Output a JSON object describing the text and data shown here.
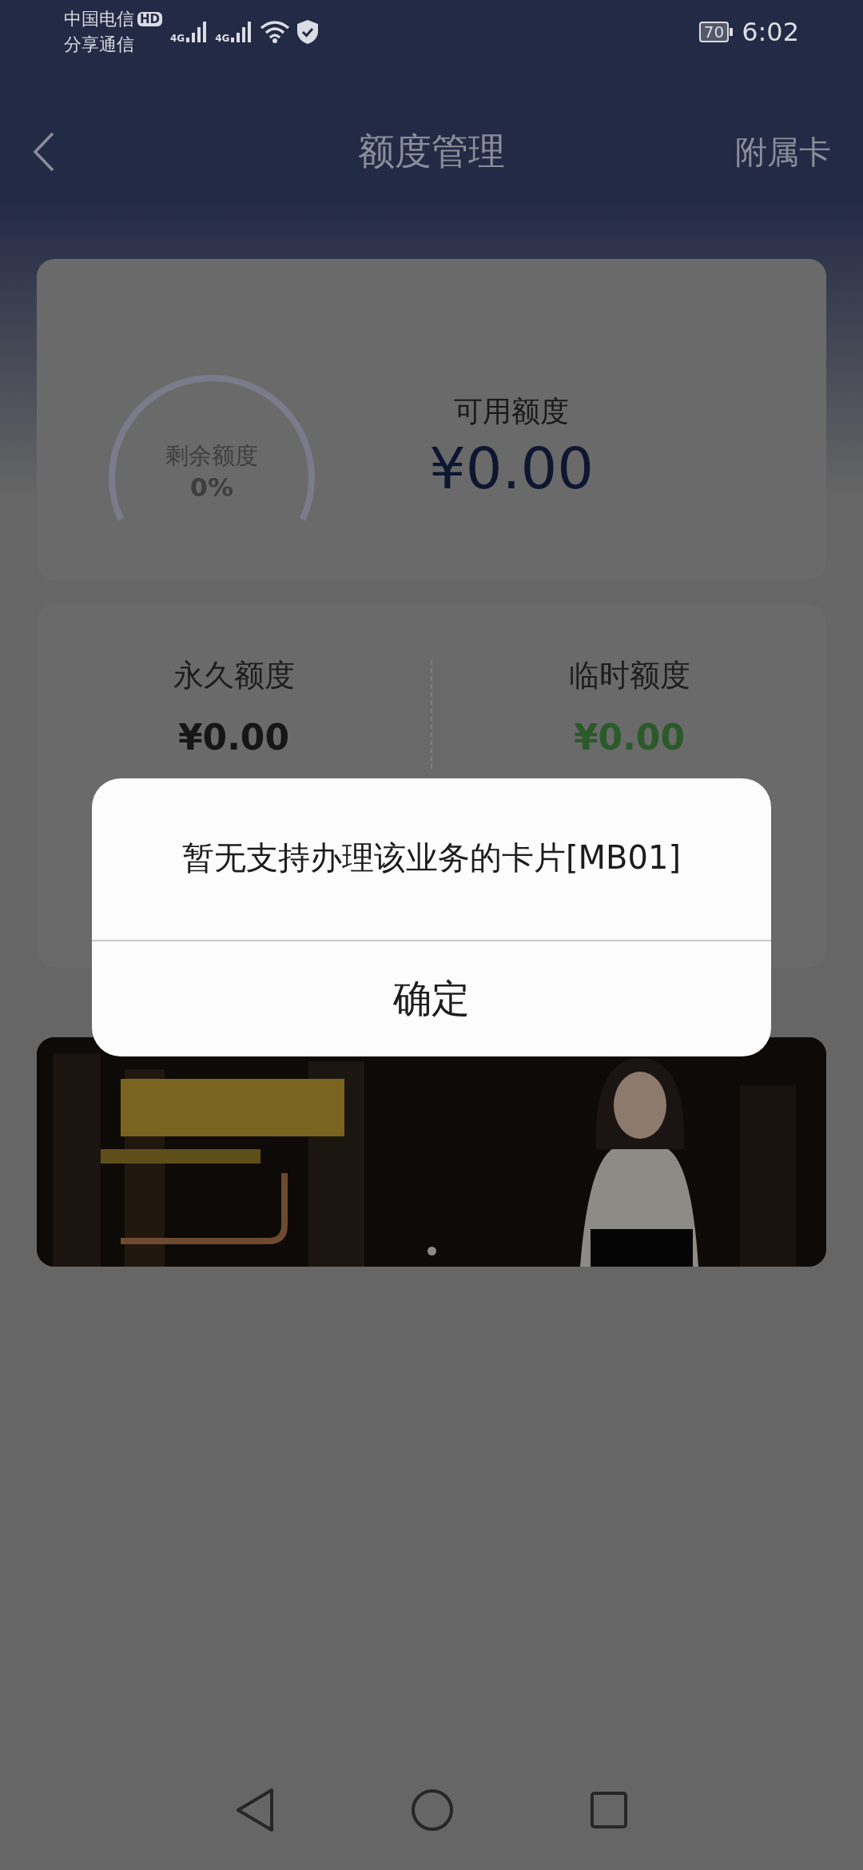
{
  "status_bar": {
    "carrier_primary": "中国电信",
    "hd_badge": "HD",
    "carrier_secondary": "分享通信",
    "network_1": "4G",
    "network_2": "4G",
    "battery": "70",
    "time": "6:02"
  },
  "header": {
    "title": "额度管理",
    "action": "附属卡"
  },
  "quota_card": {
    "gauge": {
      "label": "剩余额度",
      "percent": "0%"
    },
    "available": {
      "label": "可用额度",
      "amount": "¥0.00"
    }
  },
  "breakdown": [
    {
      "label": "永久额度",
      "amount": "¥0.00",
      "color": "#161616"
    },
    {
      "label": "临时额度",
      "amount": "¥0.00",
      "color": "#2a5a2a"
    }
  ],
  "banner": {
    "kind": "picture",
    "pages": [
      {
        "selected": true
      }
    ]
  },
  "dialog": {
    "message": "暂无支持办理该业务的卡片[MB01]",
    "button": "确定"
  }
}
